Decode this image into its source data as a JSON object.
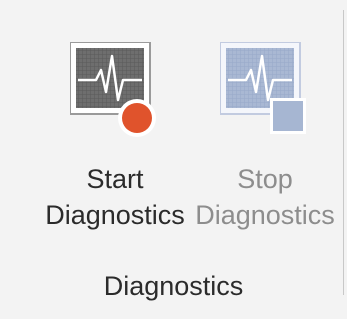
{
  "ribbon_group": {
    "label": "Diagnostics",
    "buttons": [
      {
        "line1": "Start",
        "line2": "Diagnostics",
        "enabled": true,
        "icon": "monitor-heartbeat-record-icon",
        "badge_color": "#e0532c"
      },
      {
        "line1": "Stop",
        "line2": "Diagnostics",
        "enabled": false,
        "icon": "monitor-heartbeat-stop-icon",
        "badge_color": "#a6b6d2"
      }
    ]
  }
}
